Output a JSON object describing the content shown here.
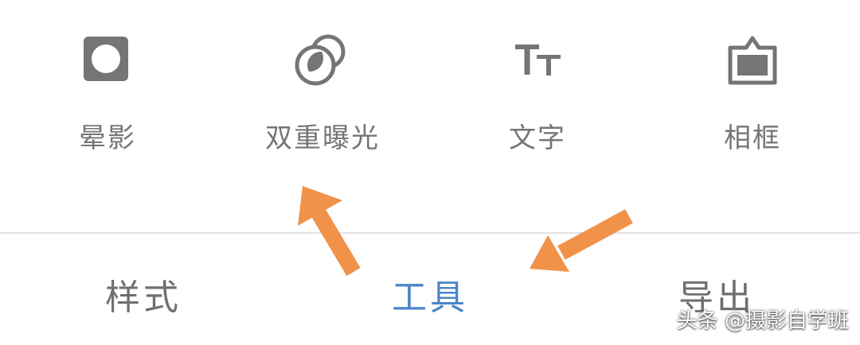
{
  "tools": [
    {
      "label": "晕影",
      "icon": "vignette-icon"
    },
    {
      "label": "双重曝光",
      "icon": "double-exposure-icon"
    },
    {
      "label": "文字",
      "icon": "text-tt-icon"
    },
    {
      "label": "相框",
      "icon": "frame-icon"
    }
  ],
  "tabs": [
    {
      "label": "样式",
      "active": false
    },
    {
      "label": "工具",
      "active": true
    },
    {
      "label": "导出",
      "active": false
    }
  ],
  "colors": {
    "icon": "#757575",
    "label": "#757575",
    "tab_inactive": "#6f6f6f",
    "tab_active": "#4a86c8",
    "annotation_arrow": "#f0924a",
    "divider": "#e3e3e3"
  },
  "watermark": "头条 @摄影自学班"
}
